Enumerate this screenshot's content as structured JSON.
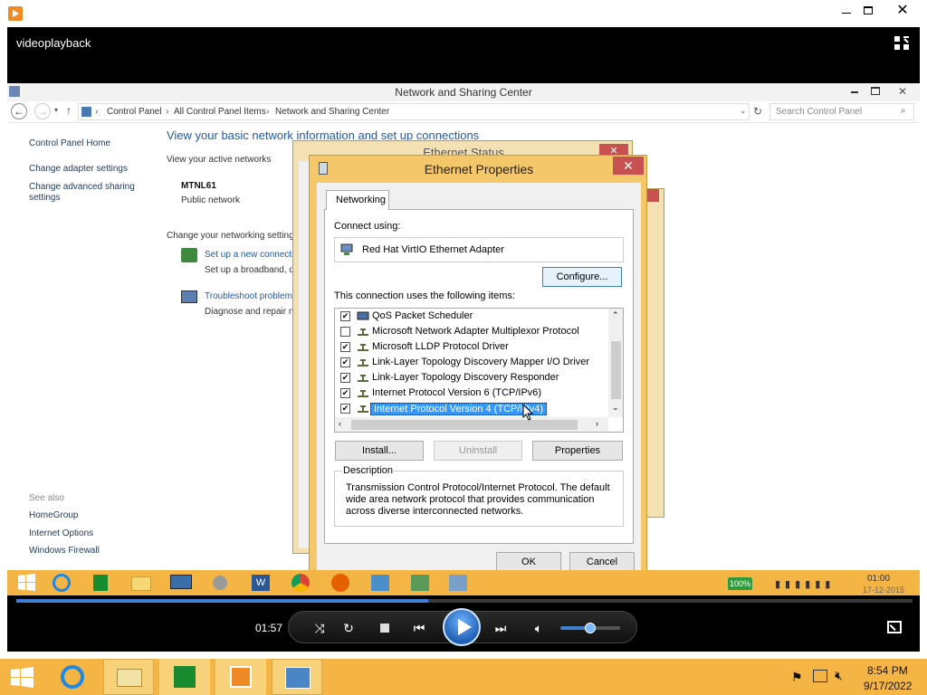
{
  "player": {
    "window_title": "videoplayback",
    "elapsed": "01:57",
    "progress": 0.46,
    "volume": 0.5
  },
  "nsc": {
    "title": "Network and Sharing Center",
    "breadcrumbs": [
      "Control Panel",
      "All Control Panel Items",
      "Network and Sharing Center"
    ],
    "search_placeholder": "Search Control Panel",
    "sidebar": {
      "home": "Control Panel Home",
      "links": [
        "Change adapter settings",
        "Change advanced sharing",
        "settings"
      ],
      "see_also_heading": "See also",
      "see_also": [
        "HomeGroup",
        "Internet Options",
        "Windows Firewall"
      ]
    },
    "heading": "View your basic network information and set up connections",
    "active_networks_label": "View your active networks",
    "network_name": "MTNL61",
    "network_type": "Public network",
    "change_settings_label": "Change your networking settings",
    "setup_link": "Set up a new connectio",
    "setup_desc": "Set up a broadband, di",
    "troubleshoot_link": "Troubleshoot problems",
    "troubleshoot_desc": "Diagnose and repair no"
  },
  "eth_status": {
    "title": "Ethernet Status"
  },
  "dialog": {
    "title": "Ethernet Properties",
    "tab": "Networking",
    "connect_using_label": "Connect using:",
    "adapter": "Red Hat VirtIO Ethernet Adapter",
    "configure_button": "Configure...",
    "items_label": "This connection uses the following items:",
    "items": [
      {
        "label": "QoS Packet Scheduler",
        "checked": true,
        "selected": false
      },
      {
        "label": "Microsoft Network Adapter Multiplexor Protocol",
        "checked": false,
        "selected": false
      },
      {
        "label": "Microsoft LLDP Protocol Driver",
        "checked": true,
        "selected": false
      },
      {
        "label": "Link-Layer Topology Discovery Mapper I/O Driver",
        "checked": true,
        "selected": false
      },
      {
        "label": "Link-Layer Topology Discovery Responder",
        "checked": true,
        "selected": false
      },
      {
        "label": "Internet Protocol Version 6 (TCP/IPv6)",
        "checked": true,
        "selected": false
      },
      {
        "label": "Internet Protocol Version 4 (TCP/IPv4)",
        "checked": true,
        "selected": true
      }
    ],
    "install_button": "Install...",
    "uninstall_button": "Uninstall",
    "properties_button": "Properties",
    "description_label": "Description",
    "description_text": "Transmission Control Protocol/Internet Protocol. The default wide area network protocol that provides communication across diverse interconnected networks.",
    "ok_button": "OK",
    "cancel_button": "Cancel"
  },
  "inner_taskbar": {
    "battery": "100%",
    "time": "01:00",
    "date": "17-12-2015"
  },
  "taskbar": {
    "time": "8:54 PM",
    "date": "9/17/2022"
  },
  "colors": {
    "taskbar": "#f4b545",
    "dialog_frame": "#f4c76b",
    "selection": "#3399ff",
    "link": "#1e5aa8",
    "close": "#c75050"
  }
}
